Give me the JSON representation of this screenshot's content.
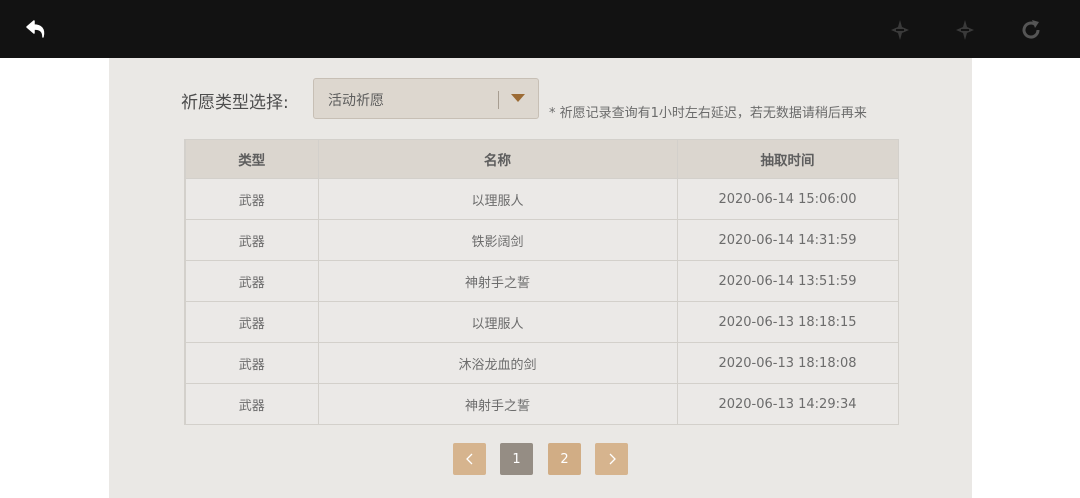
{
  "toolbar": {
    "back_icon": "back-arrow-icon",
    "forward_icon": "sparkle-arrow-icon",
    "refresh_icon": "refresh-icon"
  },
  "filter": {
    "label": "祈愿类型选择:",
    "selected": "活动祈愿",
    "note": "* 祈愿记录查询有1小时左右延迟，若无数据请稍后再来"
  },
  "table": {
    "headers": [
      "类型",
      "名称",
      "抽取时间"
    ],
    "rows": [
      [
        "武器",
        "以理服人",
        "2020-06-14 15:06:00"
      ],
      [
        "武器",
        "铁影阔剑",
        "2020-06-14 14:31:59"
      ],
      [
        "武器",
        "神射手之誓",
        "2020-06-14 13:51:59"
      ],
      [
        "武器",
        "以理服人",
        "2020-06-13 18:18:15"
      ],
      [
        "武器",
        "沐浴龙血的剑",
        "2020-06-13 18:18:08"
      ],
      [
        "武器",
        "神射手之誓",
        "2020-06-13 14:29:34"
      ]
    ]
  },
  "pagination": {
    "pages": [
      "1",
      "2"
    ],
    "current": "1"
  },
  "colors": {
    "topbar": "#121212",
    "panel": "#eae8e5",
    "accent": "#d6b48e",
    "active_page": "#958d84"
  }
}
